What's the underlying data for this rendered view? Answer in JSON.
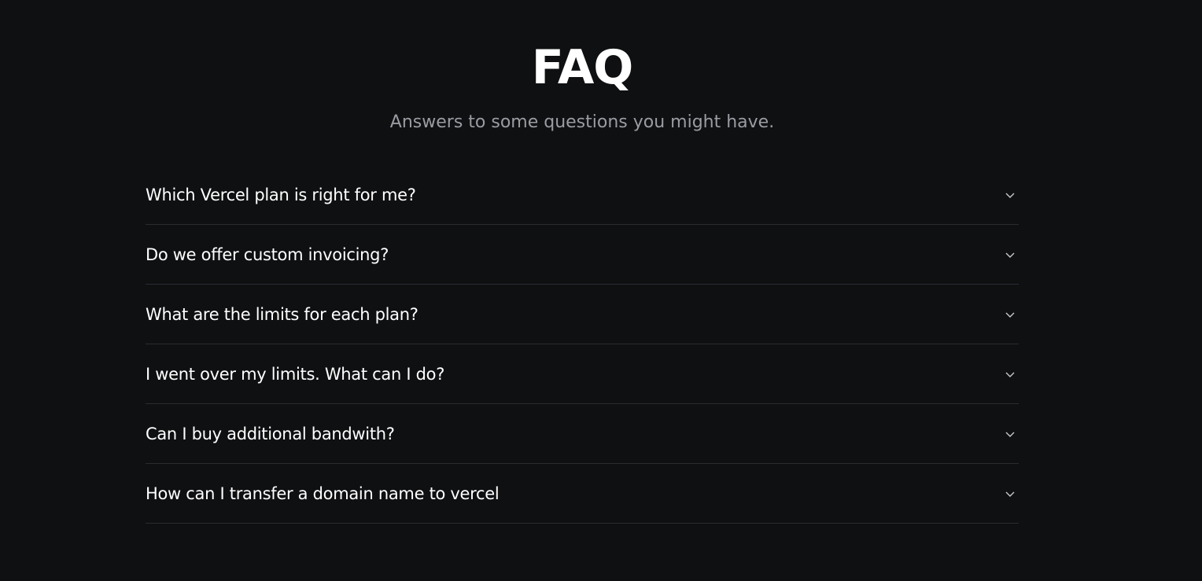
{
  "header": {
    "title": "FAQ",
    "subtitle": "Answers to some questions you might have."
  },
  "faq": {
    "items": [
      {
        "question": "Which Vercel plan is right for me?",
        "icon": "chevron-down-icon"
      },
      {
        "question": "Do we offer custom invoicing?",
        "icon": "chevron-down-icon"
      },
      {
        "question": "What are the limits for each plan?",
        "icon": "chevron-down-icon"
      },
      {
        "question": "I went over my limits. What can I do?",
        "icon": "chevron-down-icon"
      },
      {
        "question": "Can I buy additional bandwith?",
        "icon": "chevron-down-icon"
      },
      {
        "question": "How can I transfer a domain name to vercel",
        "icon": "chevron-down-icon"
      }
    ]
  },
  "colors": {
    "background": "#0f1012",
    "text": "#ffffff",
    "subtitle": "#9a9ca2",
    "divider": "#2a2c30"
  }
}
